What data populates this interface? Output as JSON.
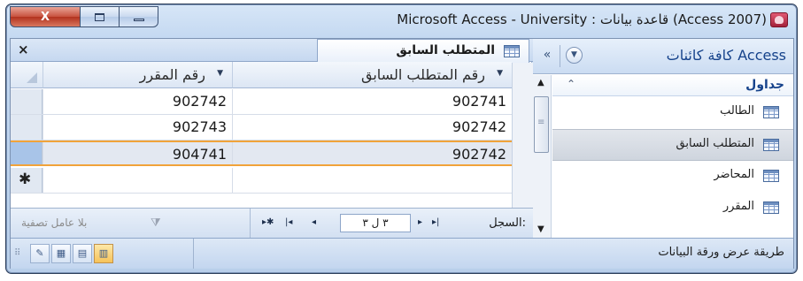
{
  "window": {
    "title": "Microsoft Access - University : قاعدة بيانات (Access 2007)",
    "close_glyph": "X"
  },
  "nav_pane": {
    "title": "كافة كائنات Access",
    "collapse_glyph": "«",
    "dropdown_glyph": "▼",
    "group": {
      "label": "جداول",
      "chevron": "⌃"
    },
    "items": [
      {
        "label": "الطالب"
      },
      {
        "label": "المتطلب السابق"
      },
      {
        "label": "المحاضر"
      },
      {
        "label": "المقرر"
      }
    ],
    "selected_index": 1
  },
  "document": {
    "tab_label": "المتطلب السابق",
    "close_glyph": "×",
    "columns": [
      {
        "label": "رقم المتطلب السابق"
      },
      {
        "label": "رقم المقرر"
      }
    ],
    "rows": [
      [
        "902741",
        "902742"
      ],
      [
        "902742",
        "902743"
      ],
      [
        "902742",
        "904741"
      ]
    ],
    "current_row": 2,
    "new_row_glyph": "✱"
  },
  "record_nav": {
    "label": "السجل:",
    "position": "٣ ل ٣",
    "filter_label": "بلا عامل تصفية",
    "first_glyph": "▸|",
    "prev_glyph": "◂"
  },
  "status_bar": {
    "text": "طريقة عرض ورقة البيانات",
    "views": [
      "datasheet",
      "pivot-table",
      "pivot-chart",
      "design"
    ]
  }
}
